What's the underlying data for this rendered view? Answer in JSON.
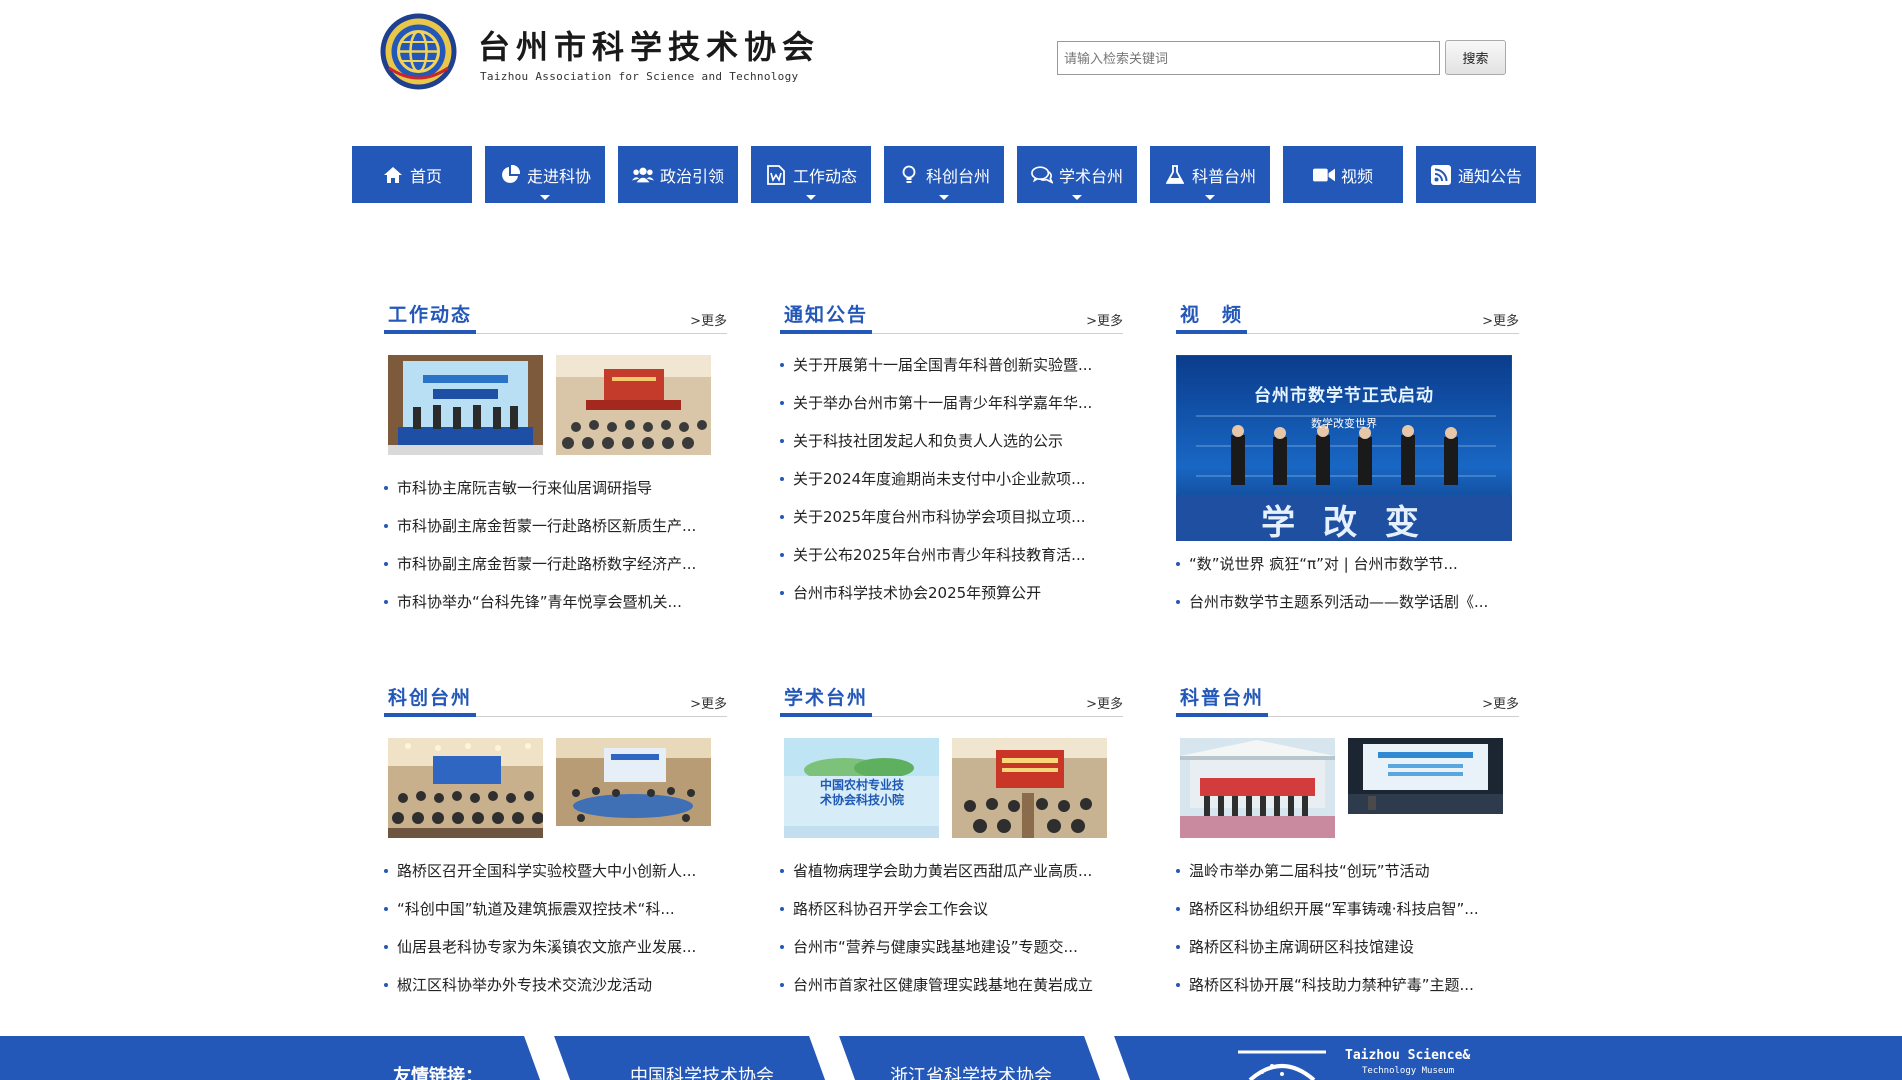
{
  "header": {
    "title_cn": "台州市科学技术协会",
    "title_en": "Taizhou Association for Science and Technology",
    "search_placeholder": "请输入检索关键词",
    "search_button": "搜索"
  },
  "nav": [
    {
      "label": "首页",
      "icon": "home-icon",
      "dropdown": false
    },
    {
      "label": "走进科协",
      "icon": "pie-chart-icon",
      "dropdown": true
    },
    {
      "label": "政治引领",
      "icon": "users-icon",
      "dropdown": false
    },
    {
      "label": "工作动态",
      "icon": "word-document-icon",
      "dropdown": true
    },
    {
      "label": "科创台州",
      "icon": "lightbulb-icon",
      "dropdown": true
    },
    {
      "label": "学术台州",
      "icon": "chat-bubbles-icon",
      "dropdown": true
    },
    {
      "label": "科普台州",
      "icon": "flask-icon",
      "dropdown": true
    },
    {
      "label": "视频",
      "icon": "video-camera-icon",
      "dropdown": false
    },
    {
      "label": "通知公告",
      "icon": "rss-icon",
      "dropdown": false
    }
  ],
  "more_label": ">更多",
  "panels": {
    "work": {
      "title": "工作动态",
      "items": [
        "市科协主席阮吉敏一行来仙居调研指导",
        "市科协副主席金哲蒙一行赴路桥区新质生产...",
        "市科协副主席金哲蒙一行赴路桥数字经济产...",
        "市科协举办“台科先锋”青年悦享会暨机关..."
      ]
    },
    "notice": {
      "title": "通知公告",
      "items": [
        "关于开展第十一届全国青年科普创新实验暨...",
        "关于举办台州市第十一届青少年科学嘉年华...",
        "关于科技社团发起人和负责人人选的公示",
        "关于2024年度逾期尚未支付中小企业款项...",
        "关于2025年度台州市科协学会项目拟立项...",
        "关于公布2025年台州市青少年科技教育活...",
        "台州市科学技术协会2025年预算公开"
      ]
    },
    "video": {
      "title": "视　频",
      "banner_text": "台州市数学节正式启动",
      "banner_sub": "数学改变世界",
      "banner_big": "学 改 变",
      "items": [
        "“数”说世界 疯狂“π”对 | 台州市数学节...",
        "台州市数学节主题系列活动——数学话剧《..."
      ]
    },
    "innovation": {
      "title": "科创台州",
      "items": [
        "路桥区召开全国科学实验校暨大中小创新人...",
        "“科创中国”轨道及建筑振震双控技术“科...",
        "仙居县老科协专家为朱溪镇农文旅产业发展...",
        "椒江区科协举办外专技术交流沙龙活动"
      ]
    },
    "academic": {
      "title": "学术台州",
      "poster_text": "中国农村专业技术协会科技小院",
      "items": [
        "省植物病理学会助力黄岩区西甜瓜产业高质...",
        "路桥区科协召开学会工作会议",
        "台州市“营养与健康实践基地建设”专题交...",
        "台州市首家社区健康管理实践基地在黄岩成立"
      ]
    },
    "popsci": {
      "title": "科普台州",
      "items": [
        "温岭市举办第二届科技“创玩”节活动",
        "路桥区科协组织开展“军事铸魂·科技启智”...",
        "路桥区科协主席调研区科技馆建设",
        "路桥区科协开展“科技助力禁种铲毒”主题..."
      ]
    }
  },
  "footer": {
    "links_label": "友情链接：",
    "link1": "中国科学技术协会",
    "link2": "浙江省科学技术协会",
    "museum_en": "Taizhou Science&",
    "museum_en2": "Technology Museum"
  },
  "colors": {
    "primary": "#2458b8",
    "text": "#222222"
  }
}
